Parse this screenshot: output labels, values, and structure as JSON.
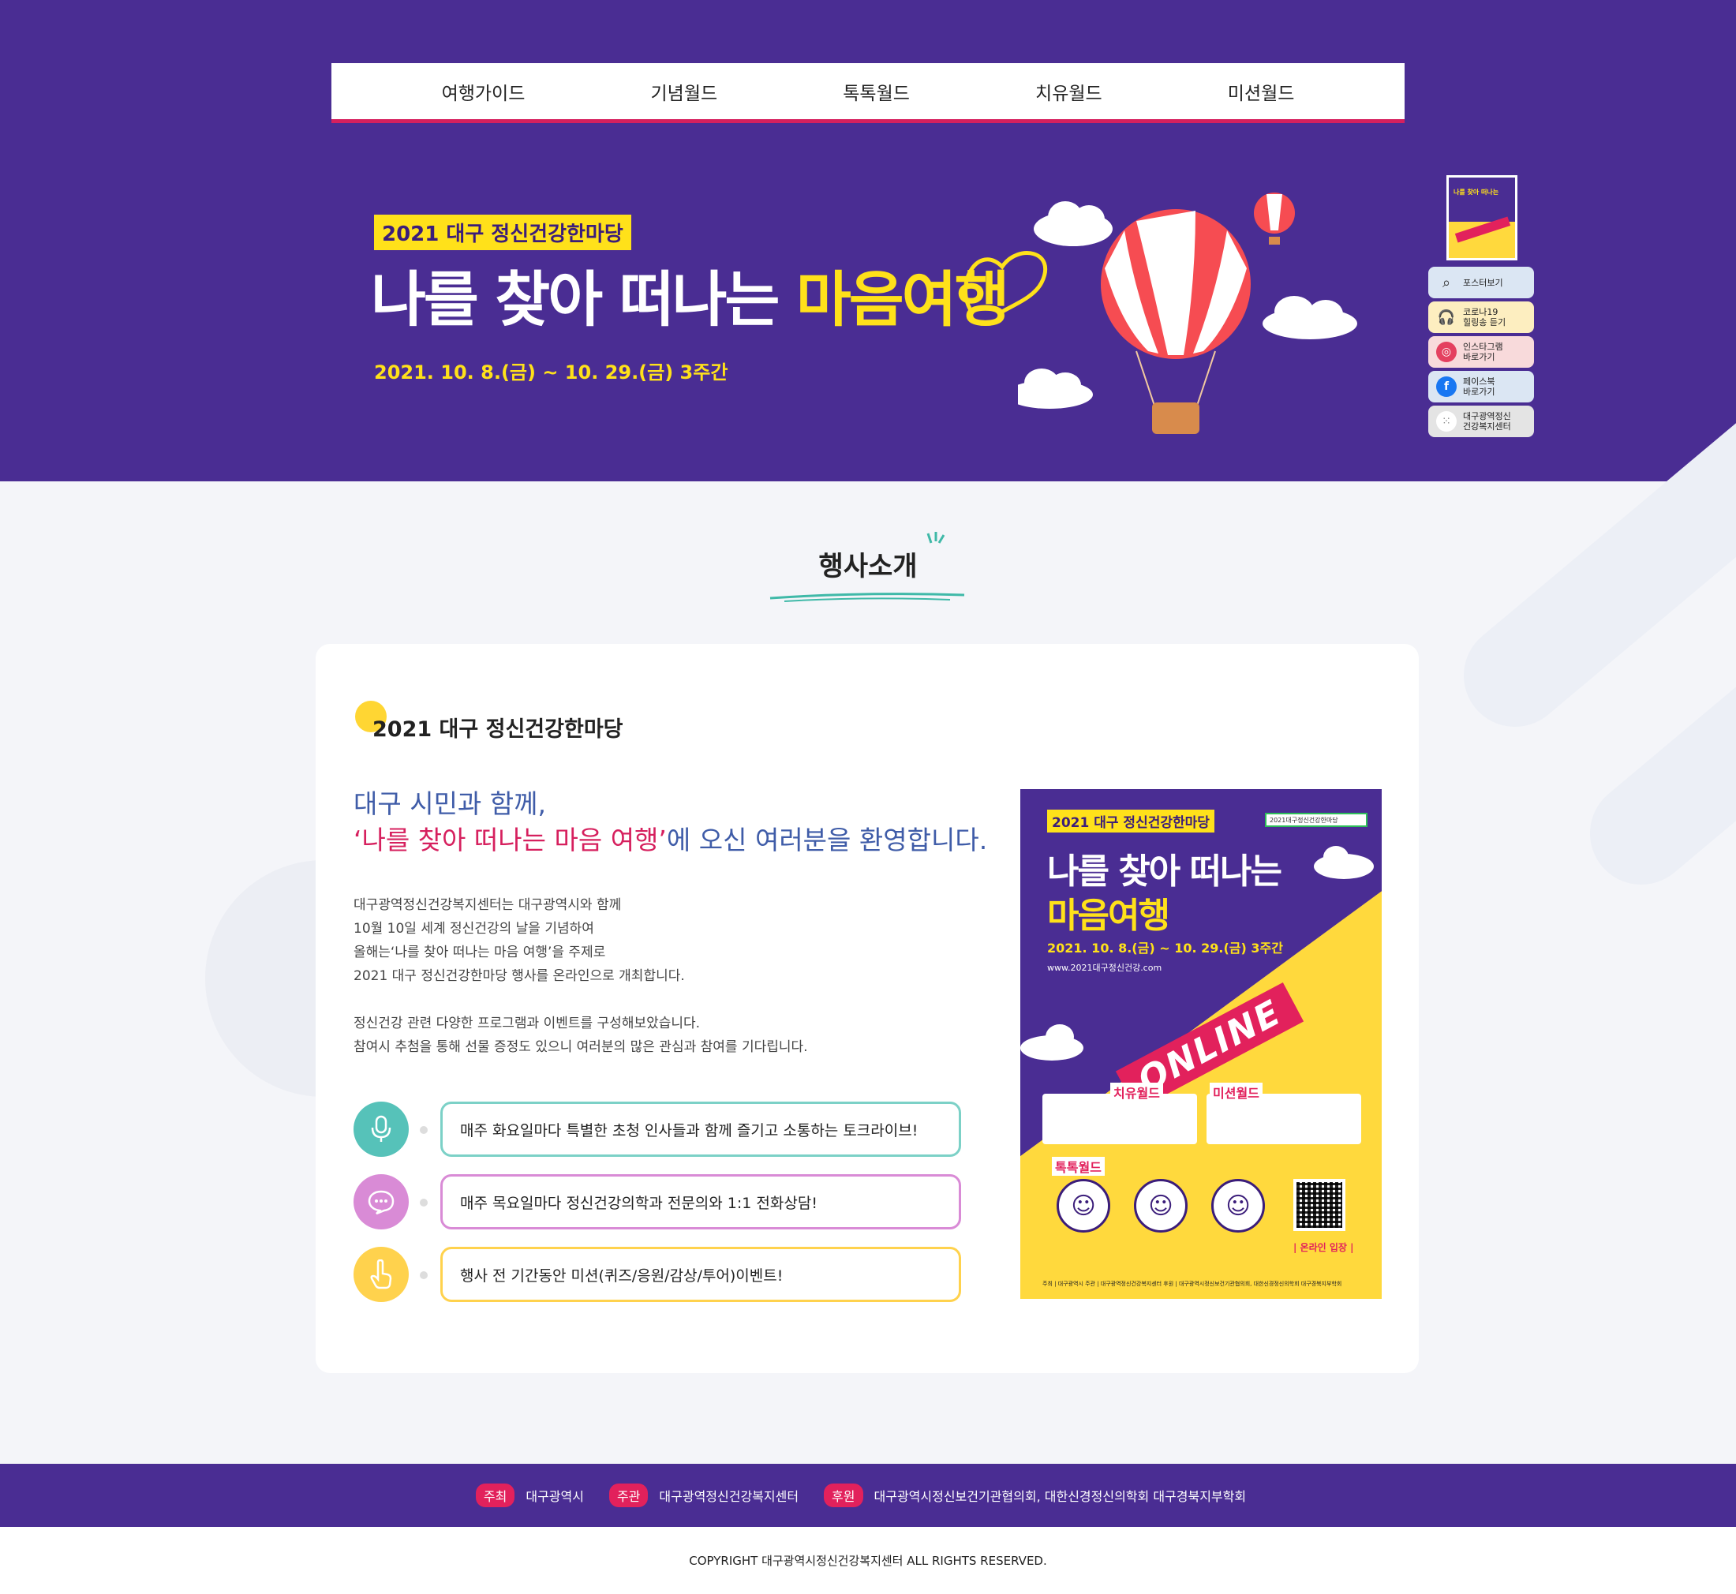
{
  "nav": {
    "items": [
      "여행가이드",
      "기념월드",
      "톡톡월드",
      "치유월드",
      "미션월드"
    ]
  },
  "hero": {
    "badge": "2021 대구 정신건강한마당",
    "title_white": "나를 찾아 떠나는 ",
    "title_yellow": "마음여행",
    "date": "2021. 10. 8.(금) ~ 10. 29.(금) 3주간"
  },
  "quick_menu": [
    {
      "icon": "search-icon",
      "label": "포스터보기"
    },
    {
      "icon": "headphones-icon",
      "label": "코로나19\n힐링송 듣기"
    },
    {
      "icon": "instagram-icon",
      "label": "인스타그램\n바로가기"
    },
    {
      "icon": "facebook-icon",
      "label": "페이스북\n바로가기"
    },
    {
      "icon": "center-logo-icon",
      "label": "대구광역정신\n건강복지센터"
    }
  ],
  "section": {
    "title": "행사소개"
  },
  "card": {
    "title": "2021 대구 정신건강한마당",
    "welcome_line1": "대구 시민과 함께,",
    "welcome_pink": "‘나를 찾아 떠나는 마음 여행’",
    "welcome_rest": "에 오신 여러분을 환영합니다.",
    "desc": [
      "대구광역정신건강복지센터는 대구광역시와 함께",
      "10월 10일 세계 정신건강의 날을 기념하여",
      "올해는‘나를 찾아 떠나는 마음 여행’을 주제로",
      "2021 대구 정신건강한마당 행사를 온라인으로 개최합니다."
    ],
    "desc2": [
      "정신건강 관련 다양한 프로그램과 이벤트를 구성해보았습니다.",
      "참여시 추첨을 통해 선물 증정도 있으니 여러분의 많은 관심과 참여를 기다립니다."
    ],
    "features": [
      {
        "icon": "microphone-icon",
        "text": "매주 화요일마다   특별한 초청 인사들과 함께 즐기고 소통하는 토크라이브!"
      },
      {
        "icon": "chat-bubble-icon",
        "text": "매주 목요일마다   정신건강의학과 전문의와 1:1 전화상담!"
      },
      {
        "icon": "tap-hand-icon",
        "text": "행사 전 기간동안  미션(퀴즈/응원/감상/투어)이벤트!"
      }
    ]
  },
  "poster": {
    "badge": "2021 대구 정신건강한마당",
    "search": "2021대구정신건강한마당",
    "title1": "나를 찾아 떠나는",
    "title2": "마음여행",
    "date": "2021. 10. 8.(금) ~ 10. 29.(금) 3주간",
    "url": "www.2021대구정신건강.com",
    "ribbon": "ONLINE",
    "label_heal": "치유월드",
    "label_mission": "미션월드",
    "label_talk": "톡톡월드",
    "enter": "| 온라인 입장 |",
    "footer": "주최 | 대구광역시  주관 | 대구광역정신건강복지센터  후원 | 대구광역시정신보건기관협의회, 대한신경정신의학회 대구경북지부학회"
  },
  "footer": {
    "host_tag": "주최",
    "host": "대구광역시",
    "organizer_tag": "주관",
    "organizer": "대구광역정신건강복지센터",
    "sponsor_tag": "후원",
    "sponsor": "대구광역시정신보건기관협의회, 대한신경정신의학회 대구경북지부학회",
    "copyright": "COPYRIGHT 대구광역시정신건강복지센터 ALL RIGHTS RESERVED."
  },
  "colors": {
    "brand_purple": "#4a2d93",
    "accent_yellow": "#ffe11a",
    "accent_pink": "#d6205e",
    "text_blue": "#3f5ca8"
  }
}
